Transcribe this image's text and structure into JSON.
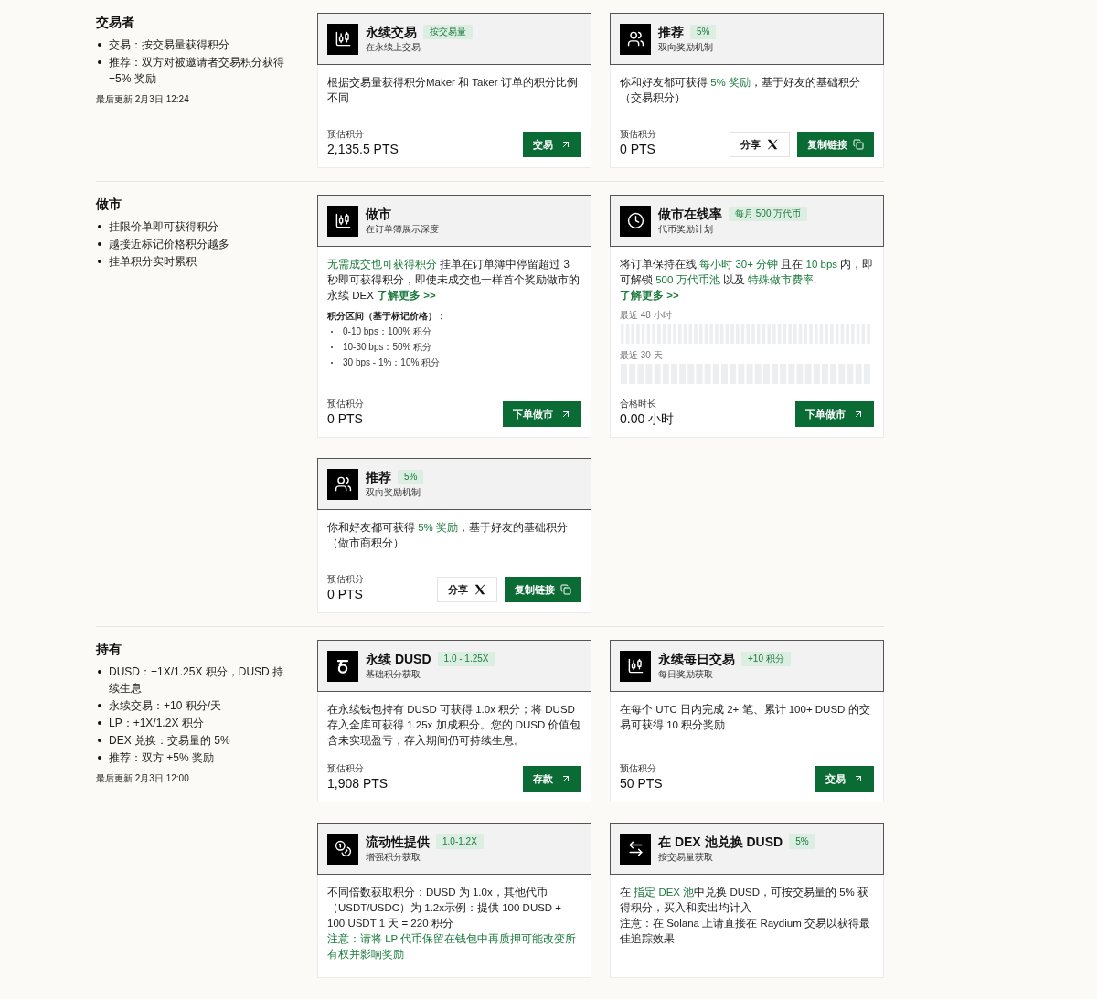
{
  "sections": [
    {
      "title": "交易者",
      "bullets": [
        "交易：按交易量获得积分",
        "推荐：双方对被邀请者交易积分获得 +5% 奖励"
      ],
      "updated": "最后更新 2月3日 12:24",
      "cards": [
        {
          "title": "永续交易",
          "badge": "按交易量",
          "subtitle": "在永续上交易",
          "body": [
            [
              {
                "kind": "plain",
                "text": "根据交易量获得积分Maker 和 Taker 订单的积分比例不同"
              }
            ]
          ],
          "estimate_label": "预估积分",
          "estimate": "2,135.5 PTS",
          "buttons": [
            {
              "kind": "action",
              "label": "交易"
            }
          ]
        },
        {
          "title": "推荐",
          "badge": "5%",
          "subtitle": "双向奖励机制",
          "body": [
            [
              {
                "kind": "plain",
                "text": "你和好友都可获得 "
              },
              {
                "kind": "highlight",
                "text": "5% 奖励"
              },
              {
                "kind": "plain",
                "text": "，基于好友的基础积分（交易积分）"
              }
            ]
          ],
          "estimate_label": "预估积分",
          "estimate": "0 PTS",
          "buttons": [
            {
              "kind": "share",
              "label": "分享"
            },
            {
              "kind": "copy",
              "label": "复制链接"
            }
          ]
        }
      ]
    },
    {
      "title": "做市",
      "bullets": [
        "挂限价单即可获得积分",
        "越接近标记价格积分越多",
        "挂单积分实时累积"
      ],
      "cards": [
        {
          "title": "做市",
          "subtitle": "在订单簿展示深度",
          "body": [
            [
              {
                "kind": "highlight",
                "text": "无需成交也可获得积分"
              },
              {
                "kind": "plain",
                "text": " 挂单在订单簿中停留超过 3 秒即可获得积分，即使未成交也一样首个奖励做市的永续 DEX "
              },
              {
                "kind": "link",
                "text": "了解更多 >>"
              }
            ]
          ],
          "tiers": {
            "heading": "积分区间（基于标记价格）：",
            "items": [
              "0-10 bps：100% 积分",
              "10-30 bps：50% 积分",
              "30 bps - 1%：10% 积分"
            ]
          },
          "estimate_label": "预估积分",
          "estimate": "0 PTS",
          "buttons": [
            {
              "kind": "action",
              "label": "下单做市"
            }
          ]
        },
        {
          "title": "做市在线率",
          "badge": "每月 500 万代币",
          "subtitle": "代币奖励计划",
          "body": [
            [
              {
                "kind": "plain",
                "text": "将订单保持在线 "
              },
              {
                "kind": "highlight",
                "text": "每小时 30+ 分钟"
              },
              {
                "kind": "plain",
                "text": " 且在 "
              },
              {
                "kind": "highlight",
                "text": "10 bps"
              },
              {
                "kind": "plain",
                "text": " 内，即可解锁 "
              },
              {
                "kind": "highlight",
                "text": "500 万代币池"
              },
              {
                "kind": "plain",
                "text": " 以及 "
              },
              {
                "kind": "highlight",
                "text": "特殊做市费率"
              },
              {
                "kind": "plain",
                "text": "."
              }
            ],
            [
              {
                "kind": "link",
                "text": "了解更多 >>"
              }
            ]
          ],
          "uptime": [
            {
              "label": "最近 48 小时"
            },
            {
              "label": "最近 30 天"
            }
          ],
          "estimate_label": "合格时长",
          "estimate": "0.00 小时",
          "buttons": [
            {
              "kind": "action",
              "label": "下单做市"
            }
          ]
        },
        {
          "title": "推荐",
          "badge": "5%",
          "subtitle": "双向奖励机制",
          "body": [
            [
              {
                "kind": "plain",
                "text": "你和好友都可获得 "
              },
              {
                "kind": "highlight",
                "text": "5% 奖励"
              },
              {
                "kind": "plain",
                "text": "，基于好友的基础积分（做市商积分）"
              }
            ]
          ],
          "estimate_label": "预估积分",
          "estimate": "0 PTS",
          "buttons": [
            {
              "kind": "share",
              "label": "分享"
            },
            {
              "kind": "copy",
              "label": "复制链接"
            }
          ]
        }
      ]
    },
    {
      "title": "持有",
      "bullets": [
        "DUSD：+1X/1.25X 积分，DUSD 持续生息",
        "永续交易：+10 积分/天",
        "LP：+1X/1.2X 积分",
        "DEX 兑换：交易量的 5%",
        "推荐：双方 +5% 奖励"
      ],
      "updated": "最后更新 2月3日 12:00",
      "cards": [
        {
          "title": "永续 DUSD",
          "badge": "1.0 - 1.25X",
          "subtitle": "基础积分获取",
          "body": [
            [
              {
                "kind": "plain",
                "text": "在永续钱包持有 DUSD 可获得 1.0x 积分；将 DUSD 存入金库可获得 1.25x 加成积分。您的 DUSD 价值包含未实现盈亏，存入期间仍可持续生息。"
              }
            ]
          ],
          "estimate_label": "预估积分",
          "estimate": "1,908 PTS",
          "buttons": [
            {
              "kind": "action",
              "label": "存款"
            }
          ]
        },
        {
          "title": "永续每日交易",
          "badge": "+10 积分",
          "subtitle": "每日奖励获取",
          "body": [
            [
              {
                "kind": "plain",
                "text": "在每个 UTC 日内完成 2+ 笔、累计 100+ DUSD 的交易可获得 10 积分奖励"
              }
            ]
          ],
          "estimate_label": "预估积分",
          "estimate": "50 PTS",
          "buttons": [
            {
              "kind": "action",
              "label": "交易"
            }
          ]
        },
        {
          "title": "流动性提供",
          "badge": "1.0-1.2X",
          "subtitle": "增强积分获取",
          "body": [
            [
              {
                "kind": "plain",
                "text": "不同倍数获取积分：DUSD 为 1.0x，其他代币（USDT/USDC）为 1.2x示例：提供 100 DUSD + 100 USDT 1 天 = 220 积分"
              }
            ],
            [
              {
                "kind": "highlight",
                "text": "注意：请将 LP 代币保留在钱包中再质押可能改变所有权并影响奖励"
              }
            ]
          ]
        },
        {
          "title": "在 DEX 池兑换 DUSD",
          "badge": "5%",
          "subtitle": "按交易量获取",
          "body": [
            [
              {
                "kind": "plain",
                "text": "在 "
              },
              {
                "kind": "highlight",
                "text": "指定 DEX 池"
              },
              {
                "kind": "plain",
                "text": "中兑换 DUSD，可按交易量的 5% 获得积分，买入和卖出均计入"
              }
            ],
            [
              {
                "kind": "plain",
                "text": "注意：在 Solana 上请直接在 Raydium 交易以获得最佳追踪效果"
              }
            ]
          ]
        }
      ]
    }
  ]
}
